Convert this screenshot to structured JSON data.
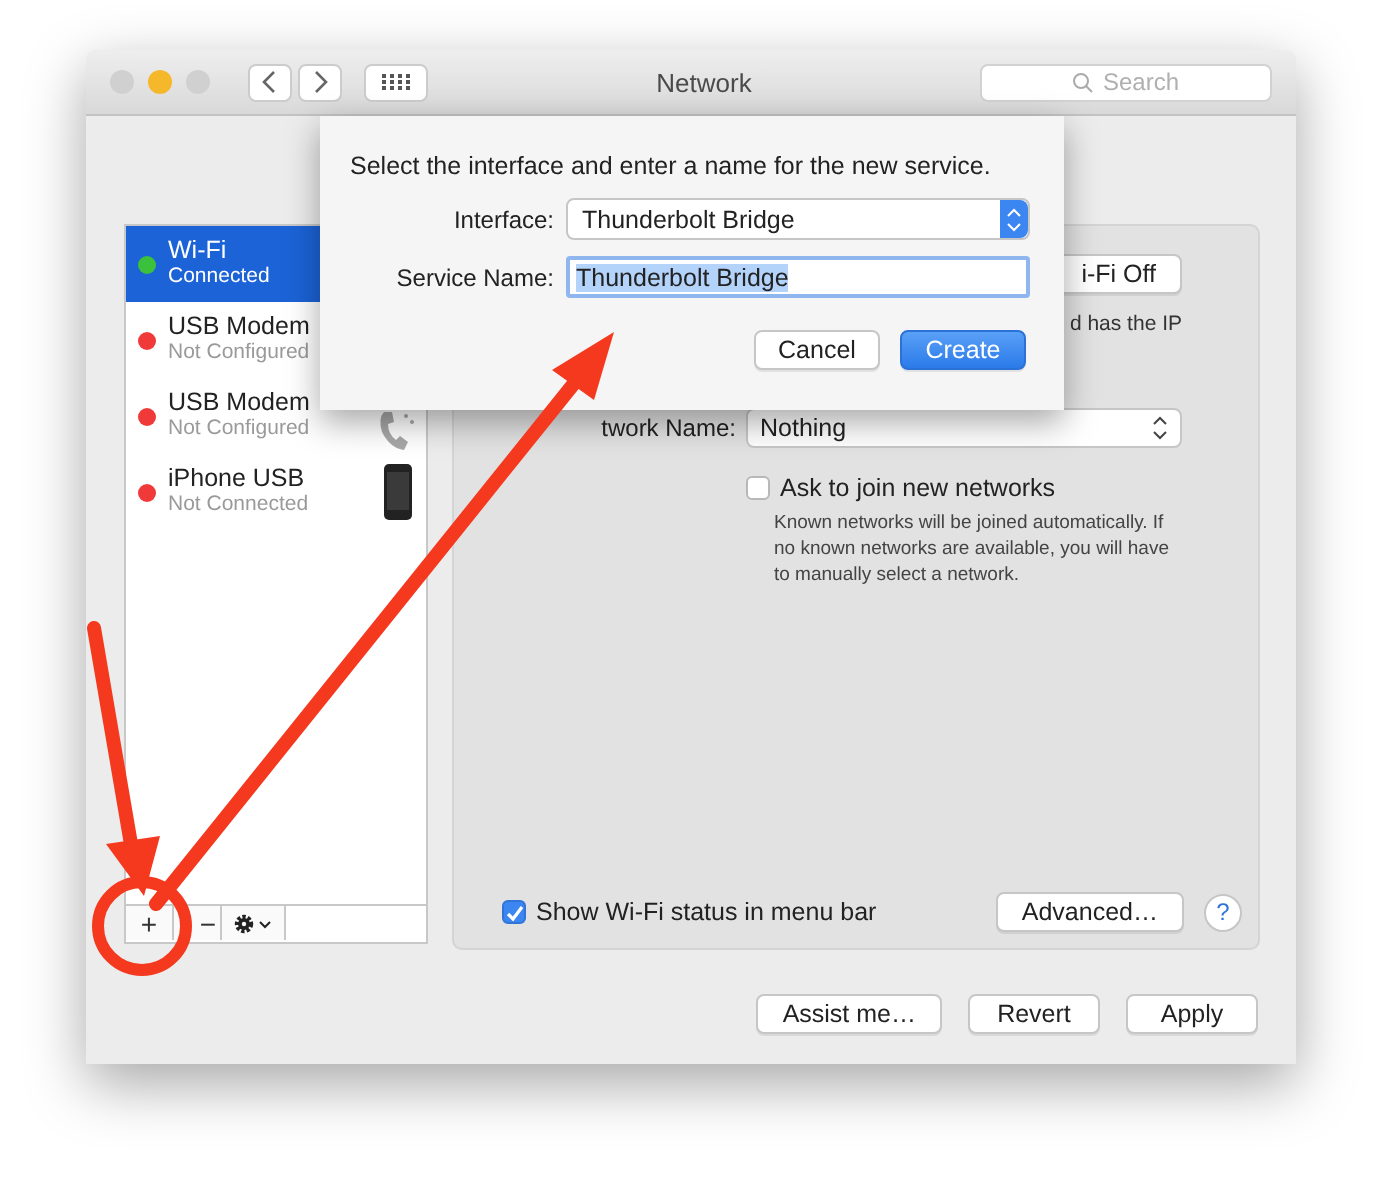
{
  "window": {
    "title": "Network"
  },
  "search": {
    "placeholder": "Search"
  },
  "services": [
    {
      "name": "Wi-Fi",
      "status": "Connected",
      "color": "#3cc13c",
      "selected": true,
      "kind": "wifi"
    },
    {
      "name": "USB Modem",
      "status": "Not Configured",
      "color": "#f03a3a",
      "selected": false,
      "kind": "modem"
    },
    {
      "name": "USB Modem",
      "status": "Not Configured",
      "color": "#f03a3a",
      "selected": false,
      "kind": "modem"
    },
    {
      "name": "iPhone USB",
      "status": "Not Connected",
      "color": "#f03a3a",
      "selected": false,
      "kind": "iphone"
    }
  ],
  "service_toolbar": {
    "add": "+",
    "remove": "−"
  },
  "panel": {
    "wifi_button": "i-Fi Off",
    "status_text": "d has the IP",
    "network_name_label": "twork Name:",
    "network_name": "Nothing",
    "ask_to_join": {
      "label": "Ask to join new networks",
      "checked": false
    },
    "ask_help": "Known networks will be joined automatically. If no known networks are available, you will have to manually select a network.",
    "show_status": {
      "label": "Show Wi-Fi status in menu bar",
      "checked": true
    },
    "advanced_button": "Advanced…",
    "help_button": "?"
  },
  "buttons": [
    "Assist me…",
    "Revert",
    "Apply"
  ],
  "sheet": {
    "prompt": "Select the interface and enter a name for the new service.",
    "interface_label": "Interface:",
    "interface_value": "Thunderbolt Bridge",
    "service_name_label": "Service Name:",
    "service_name_value": "Thunderbolt Bridge",
    "value_selected": true,
    "buttons": [
      {
        "label": "Cancel",
        "default": false
      },
      {
        "label": "Create",
        "default": true
      }
    ]
  }
}
